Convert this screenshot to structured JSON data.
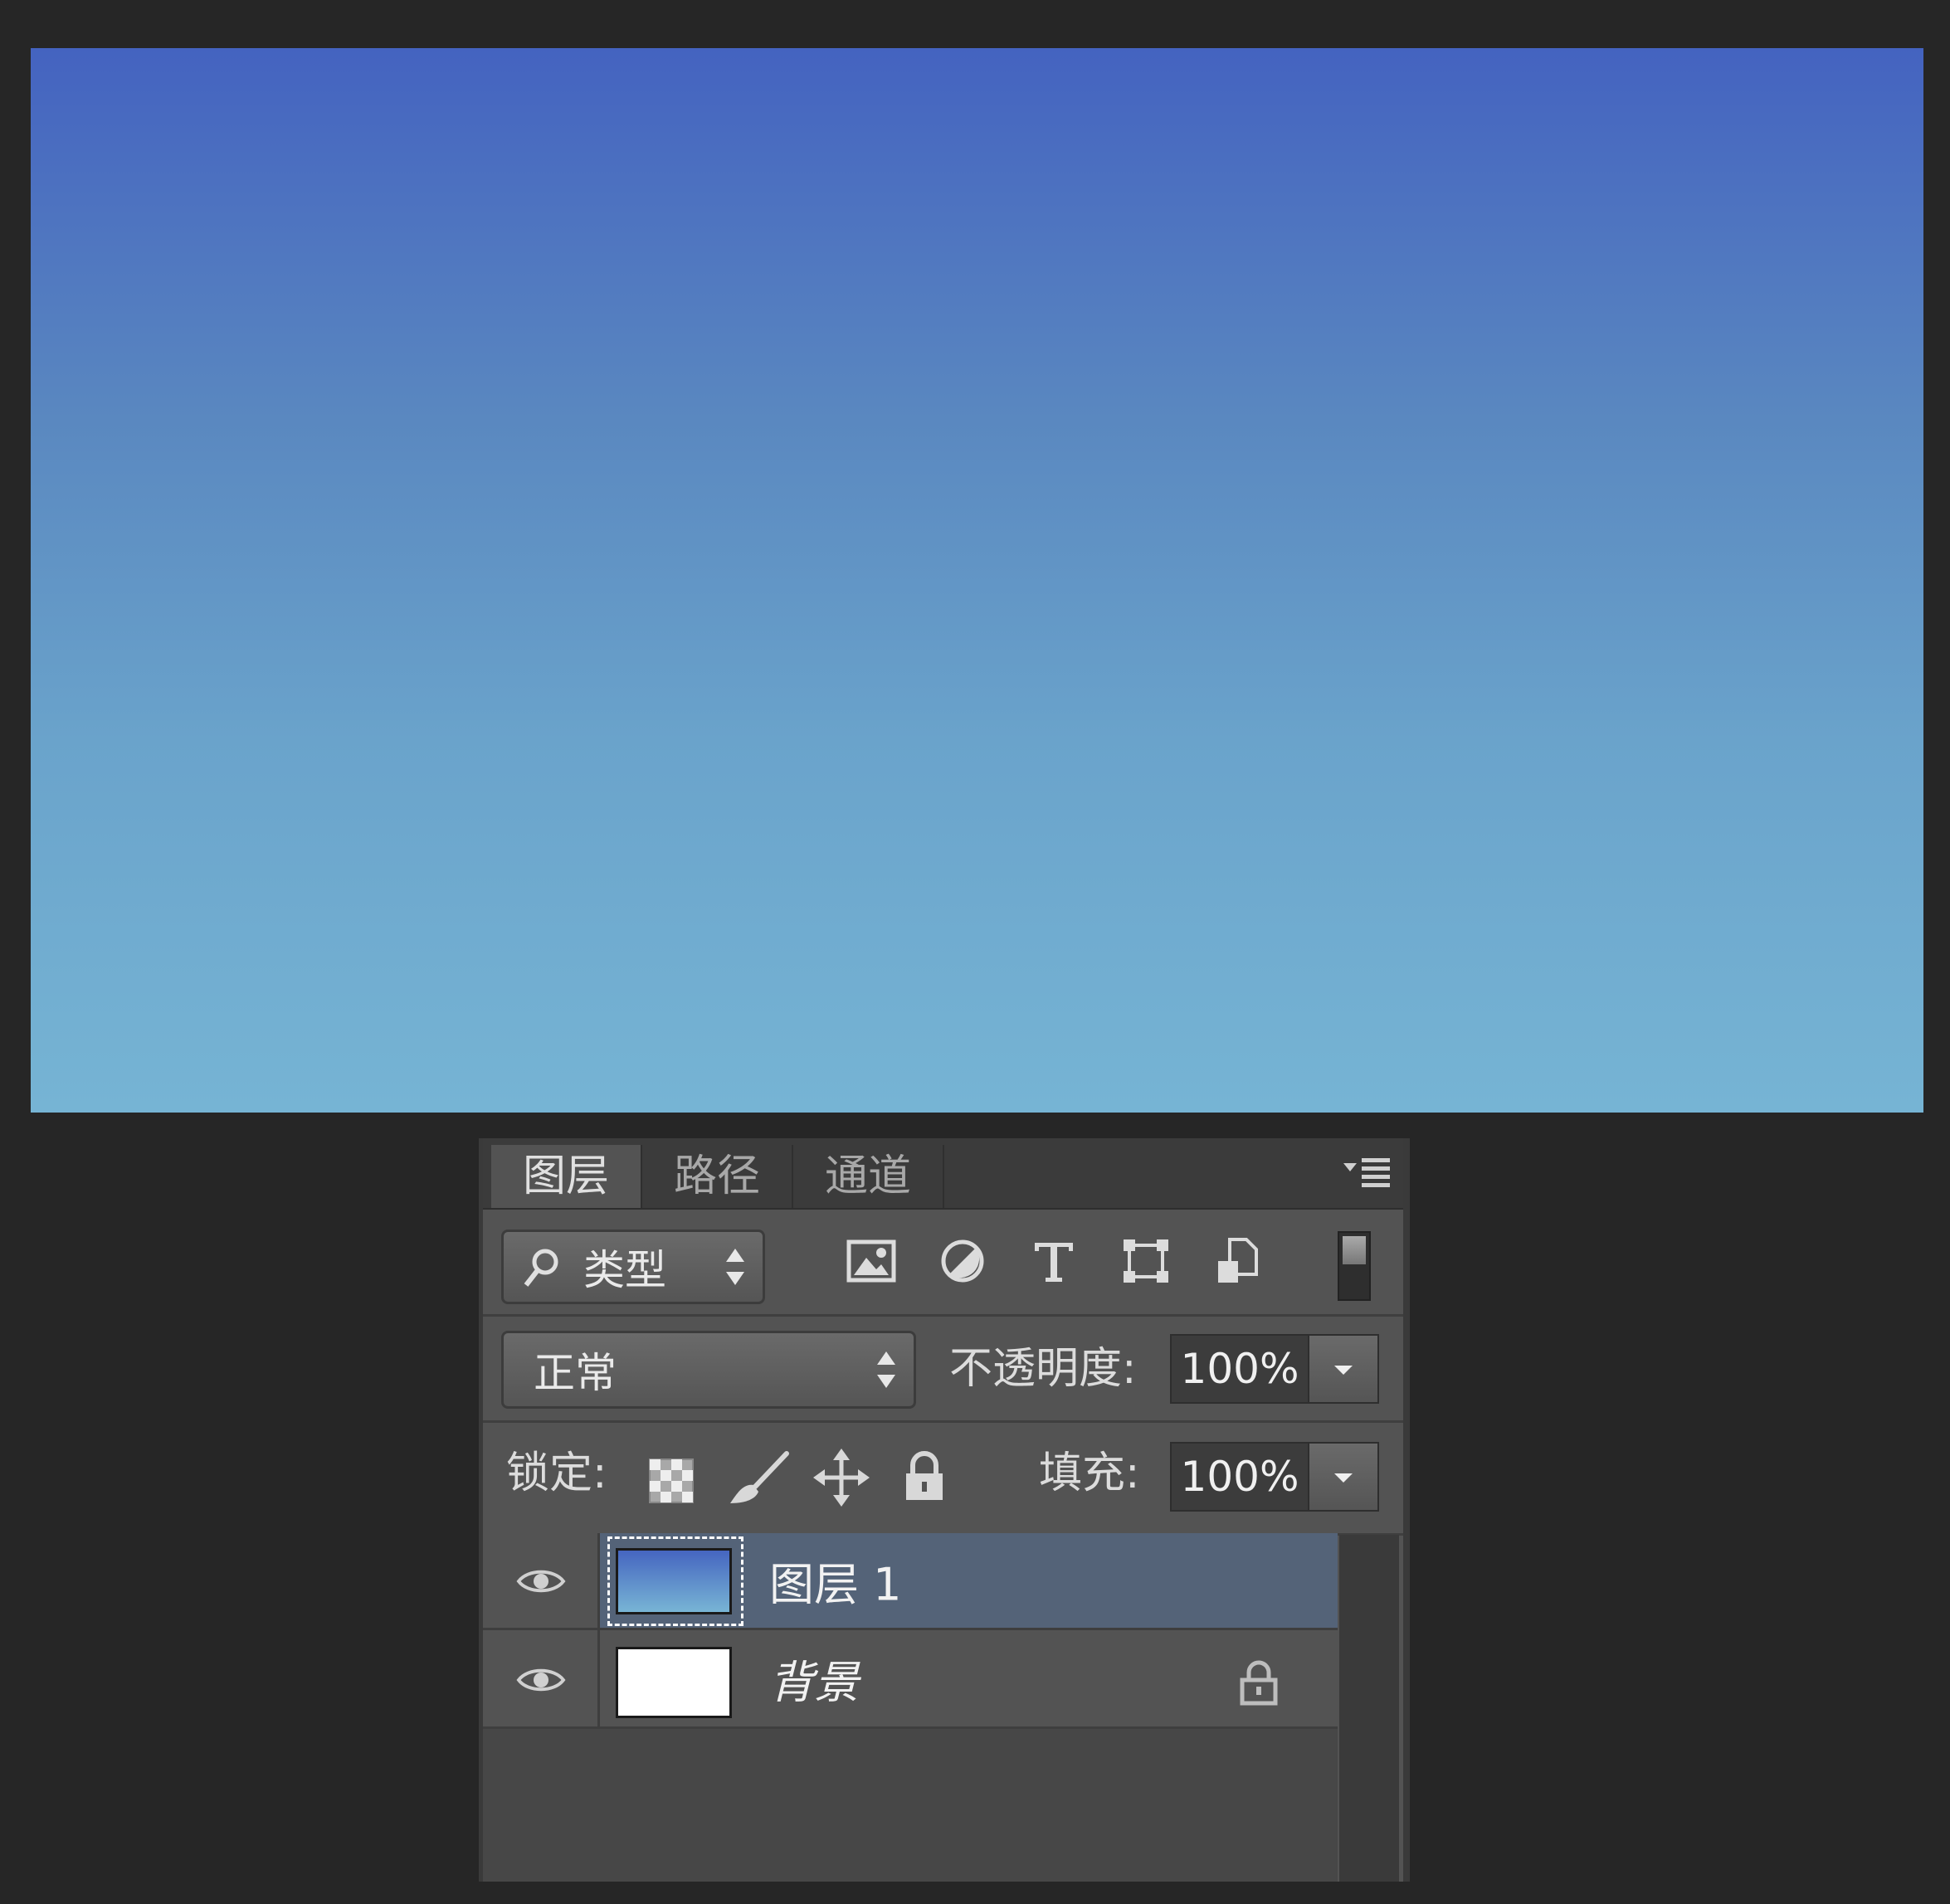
{
  "canvas": {
    "gradient_top": "#4463c0",
    "gradient_bottom": "#76b4d4"
  },
  "panel": {
    "tabs": [
      {
        "label": "图层",
        "active": true
      },
      {
        "label": "路径",
        "active": false
      },
      {
        "label": "通道",
        "active": false
      }
    ],
    "menu_icon": "panel-menu-icon",
    "filter": {
      "kind_label": "类型",
      "icons": [
        "image-filter-icon",
        "adjustment-filter-icon",
        "type-filter-icon",
        "shape-filter-icon",
        "smart-object-filter-icon"
      ]
    },
    "blend": {
      "mode": "正常",
      "opacity_label": "不透明度:",
      "opacity_value": "100%"
    },
    "lock": {
      "label": "锁定:",
      "icons": [
        "lock-transparent-icon",
        "lock-paint-icon",
        "lock-position-icon",
        "lock-all-icon"
      ],
      "fill_label": "填充:",
      "fill_value": "100%"
    },
    "layers": [
      {
        "name": "图层 1",
        "selected": true,
        "visible": true,
        "thumb_color_top": "#4565c0",
        "thumb_color_bottom": "#78b5d5"
      },
      {
        "name": "背景",
        "selected": false,
        "visible": true,
        "locked": true,
        "thumb_color": "#ffffff"
      }
    ],
    "colors": {
      "selected_row": "#546378",
      "row": "#535353"
    }
  }
}
